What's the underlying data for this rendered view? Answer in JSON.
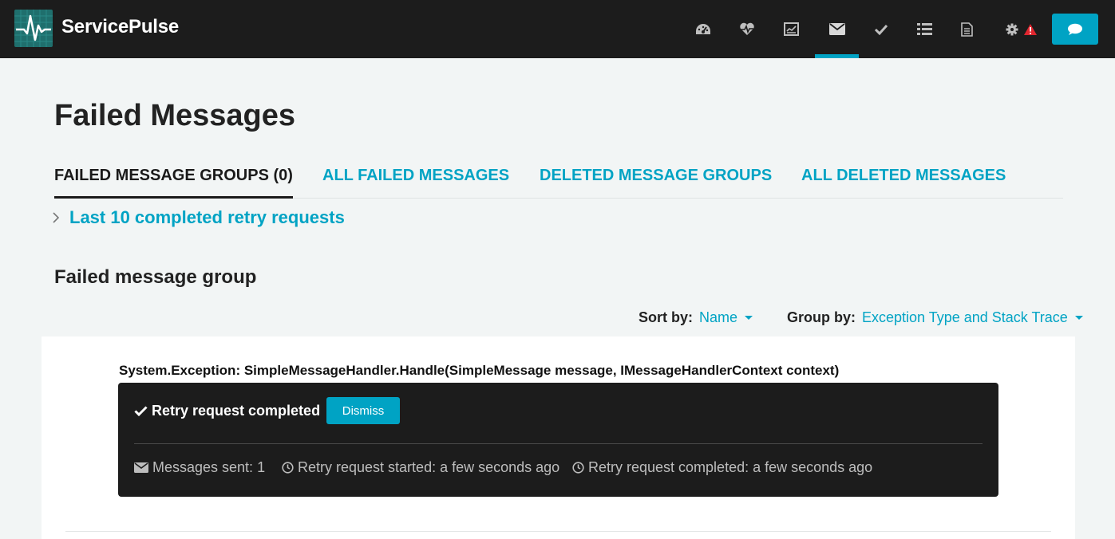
{
  "app": {
    "name": "ServicePulse"
  },
  "nav": {
    "items": [
      {
        "name": "dashboard",
        "icon": "dashboard-gauge-icon"
      },
      {
        "name": "heartbeats",
        "icon": "heartbeat-icon"
      },
      {
        "name": "monitoring",
        "icon": "monitoring-chart-icon"
      },
      {
        "name": "failed-messages",
        "icon": "envelope-icon",
        "active": true
      },
      {
        "name": "custom-checks",
        "icon": "check-icon"
      },
      {
        "name": "events",
        "icon": "list-icon"
      },
      {
        "name": "audit",
        "icon": "document-icon"
      },
      {
        "name": "configuration",
        "icon": "gear-icon",
        "alert": "warning-triangle-icon"
      }
    ],
    "feedback_icon": "chat-bubble-icon"
  },
  "page": {
    "title": "Failed Messages",
    "tabs": [
      {
        "label": "FAILED MESSAGE GROUPS (0)",
        "active": true
      },
      {
        "label": "ALL FAILED MESSAGES"
      },
      {
        "label": "DELETED MESSAGE GROUPS"
      },
      {
        "label": "ALL DELETED MESSAGES"
      }
    ],
    "history_link": "Last 10 completed retry requests",
    "section_title": "Failed message group",
    "sort": {
      "label": "Sort by:",
      "value": "Name"
    },
    "group_by": {
      "label": "Group by:",
      "value": "Exception Type and Stack Trace"
    }
  },
  "group": {
    "title": "System.Exception: SimpleMessageHandler.Handle(SimpleMessage message, IMessageHandlerContext context)",
    "retry": {
      "status": "Retry request completed",
      "dismiss_label": "Dismiss",
      "messages_sent": "Messages sent: 1",
      "started": "Retry request started: a few seconds ago",
      "completed": "Retry request completed: a few seconds ago"
    }
  },
  "colors": {
    "accent": "#00a3c4",
    "navbar": "#1c1c1c",
    "background": "#f2f5f5",
    "alert": "#e0262f"
  }
}
